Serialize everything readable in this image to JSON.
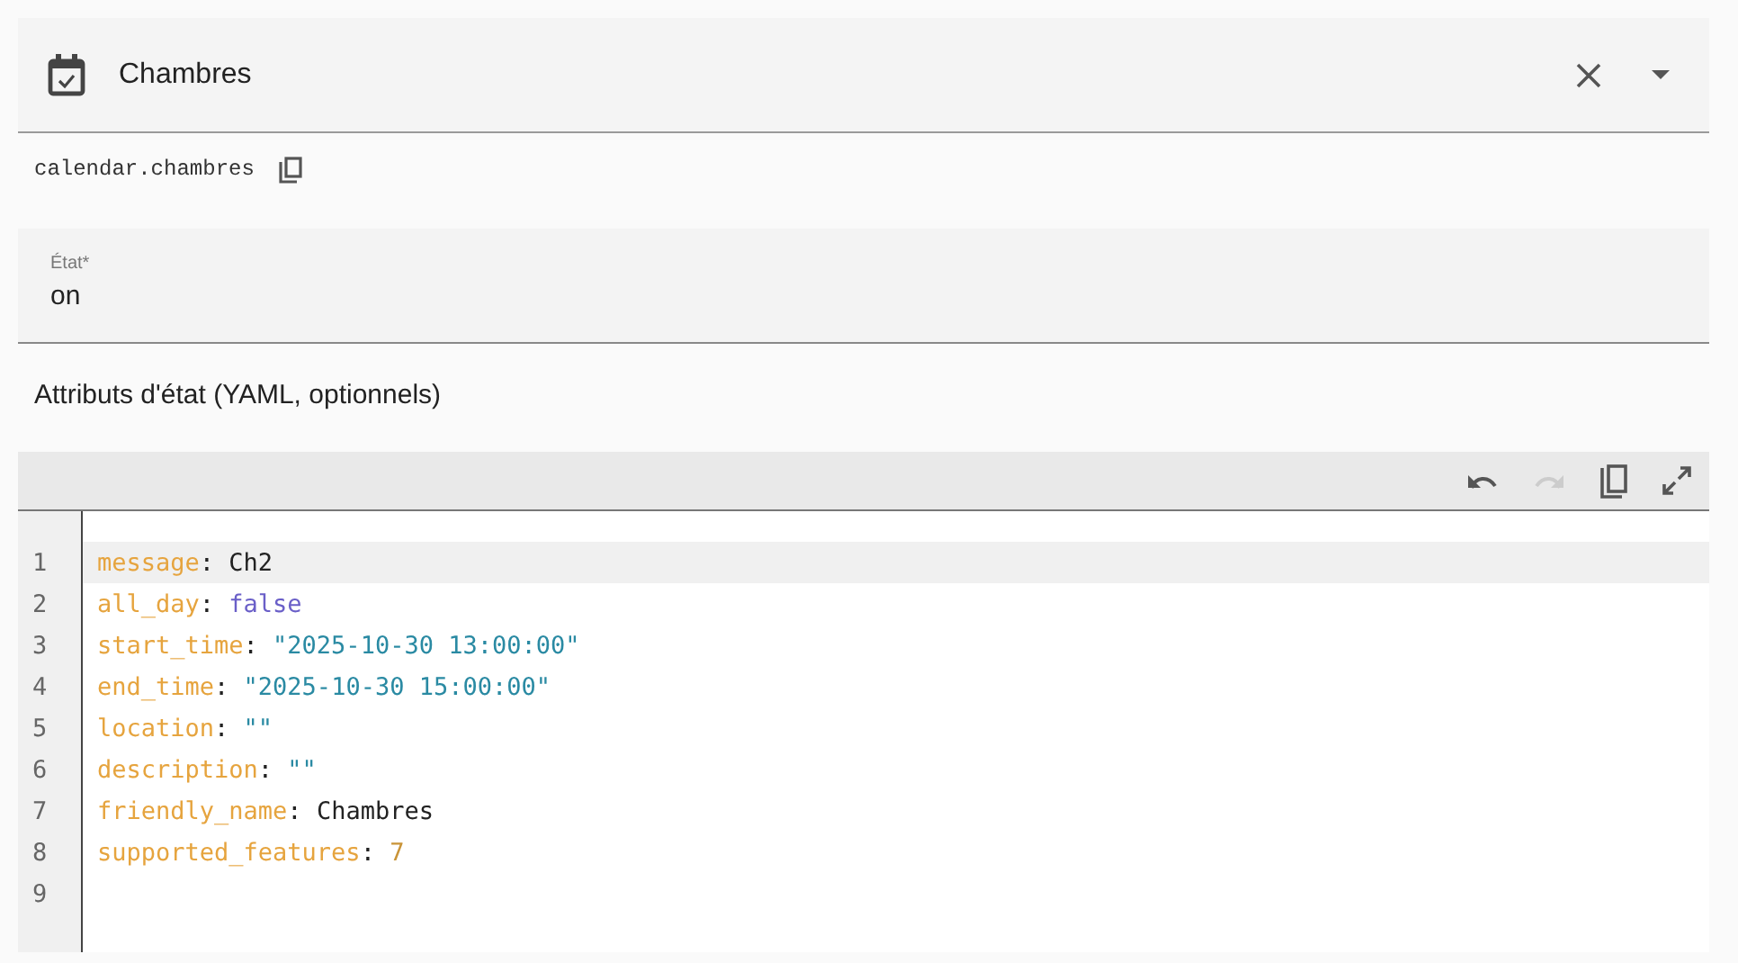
{
  "header": {
    "title": "Chambres"
  },
  "entity_id": "calendar.chambres",
  "state_field": {
    "label": "État*",
    "value": "on"
  },
  "attributes_label": "Attributs d'état (YAML, optionnels)",
  "editor": {
    "redo_disabled": true,
    "lines": [
      {
        "number": "1",
        "key": "message",
        "sep": ":",
        "value": "Ch2",
        "kind": "plain",
        "active": true
      },
      {
        "number": "2",
        "key": "all_day",
        "sep": ":",
        "value": "false",
        "kind": "bool",
        "active": false
      },
      {
        "number": "3",
        "key": "start_time",
        "sep": ":",
        "value": "\"2025-10-30 13:00:00\"",
        "kind": "string",
        "active": false
      },
      {
        "number": "4",
        "key": "end_time",
        "sep": ":",
        "value": "\"2025-10-30 15:00:00\"",
        "kind": "string",
        "active": false
      },
      {
        "number": "5",
        "key": "location",
        "sep": ":",
        "value": "\"\"",
        "kind": "string",
        "active": false
      },
      {
        "number": "6",
        "key": "description",
        "sep": ":",
        "value": "\"\"",
        "kind": "string",
        "active": false
      },
      {
        "number": "7",
        "key": "friendly_name",
        "sep": ":",
        "value": "Chambres",
        "kind": "plain",
        "active": false
      },
      {
        "number": "8",
        "key": "supported_features",
        "sep": ":",
        "value": "7",
        "kind": "number",
        "active": false
      },
      {
        "number": "9",
        "kind": "empty",
        "active": false
      }
    ]
  }
}
